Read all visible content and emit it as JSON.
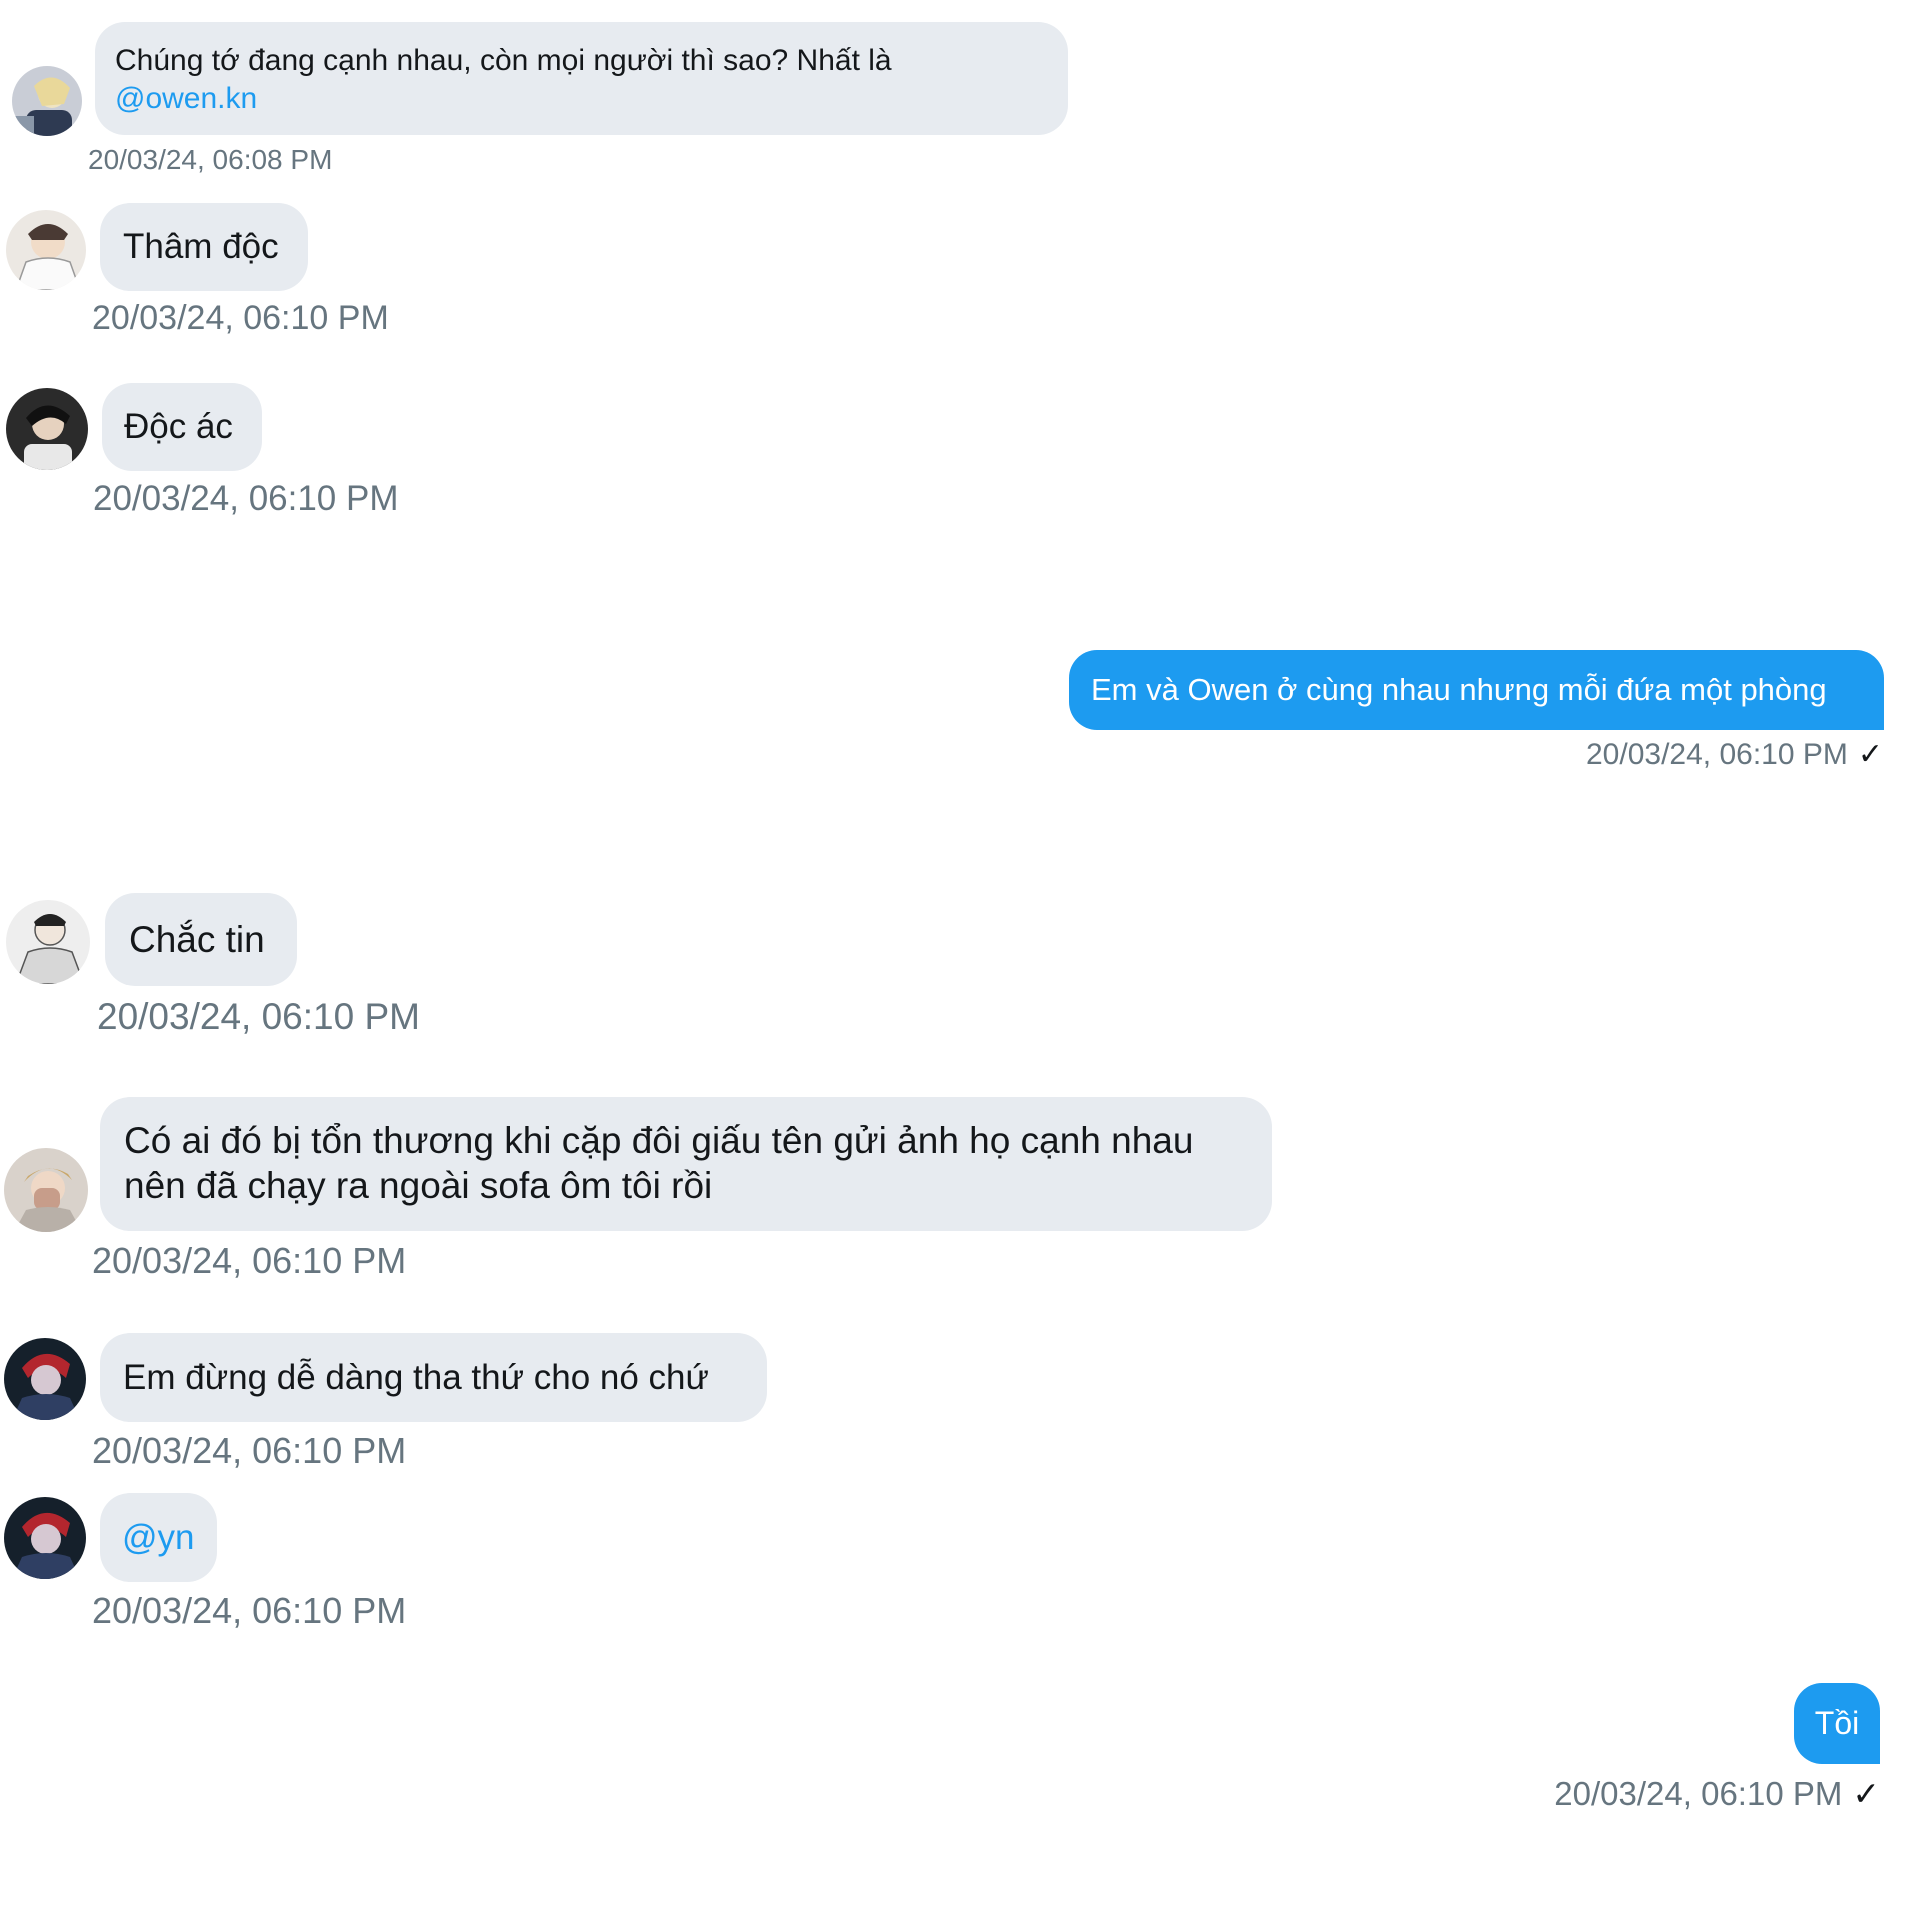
{
  "messages": [
    {
      "sender": "other",
      "text": "Chúng tớ đang cạnh nhau, còn mọi người thì sao? Nhất là",
      "mention": "@owen.kn",
      "time": "20/03/24, 06:08 PM"
    },
    {
      "sender": "other",
      "text": "Thâm độc",
      "time": "20/03/24, 06:10 PM"
    },
    {
      "sender": "other",
      "text": "Độc ác",
      "time": "20/03/24, 06:10 PM"
    },
    {
      "sender": "me",
      "text": "Em và Owen ở cùng nhau nhưng mỗi đứa một phòng",
      "time": "20/03/24, 06:10 PM",
      "status": "✓"
    },
    {
      "sender": "other",
      "text": "Chắc tin",
      "time": "20/03/24, 06:10 PM"
    },
    {
      "sender": "other",
      "text_line1": "Có ai đó bị tổn thương khi cặp đôi giấu tên gửi ảnh họ cạnh nhau",
      "text_line2": "nên đã chạy ra ngoài sofa ôm tôi rồi",
      "time": "20/03/24, 06:10 PM"
    },
    {
      "sender": "other",
      "text": "Em đừng dễ dàng tha thứ cho nó chứ",
      "time": "20/03/24, 06:10 PM"
    },
    {
      "sender": "other",
      "mention": "@yn",
      "time": "20/03/24, 06:10 PM"
    },
    {
      "sender": "me",
      "text": "Tồi",
      "time": "20/03/24, 06:10 PM",
      "status": "✓"
    }
  ],
  "colors": {
    "incoming_bubble": "#e7ebf0",
    "outgoing_bubble": "#1d9bf0",
    "mention": "#1d9bf0",
    "timestamp": "#66757f"
  }
}
